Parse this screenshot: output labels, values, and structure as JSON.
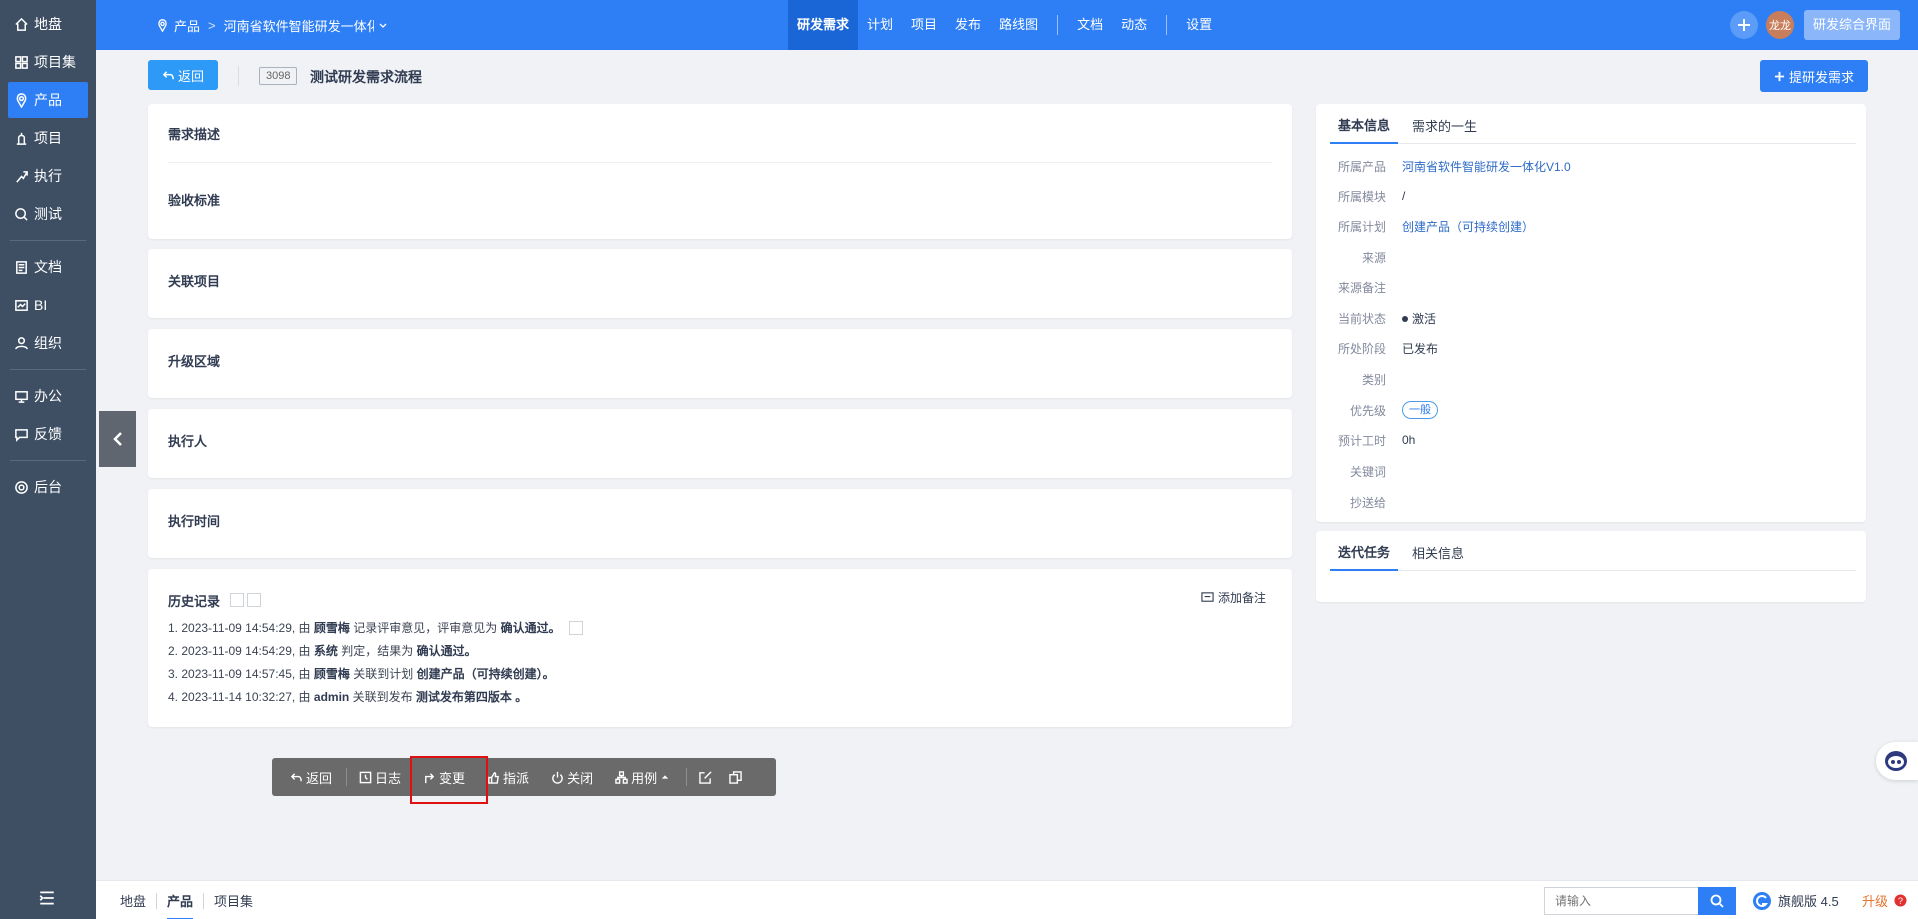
{
  "sidebar": {
    "items": [
      {
        "label": "地盘",
        "icon": "home-icon"
      },
      {
        "label": "项目集",
        "icon": "program-icon"
      },
      {
        "label": "产品",
        "icon": "product-icon"
      },
      {
        "label": "项目",
        "icon": "project-icon"
      },
      {
        "label": "执行",
        "icon": "execution-icon"
      },
      {
        "label": "测试",
        "icon": "test-icon"
      },
      {
        "label": "文档",
        "icon": "doc-icon"
      },
      {
        "label": "BI",
        "icon": "bi-icon"
      },
      {
        "label": "组织",
        "icon": "org-icon"
      },
      {
        "label": "办公",
        "icon": "office-icon"
      },
      {
        "label": "反馈",
        "icon": "feedback-icon"
      },
      {
        "label": "后台",
        "icon": "admin-icon"
      }
    ],
    "active": "产品"
  },
  "topbar": {
    "crumb_product": "产品",
    "crumb_current": "河南省软件智能研发一体化",
    "nav": [
      "研发需求",
      "计划",
      "项目",
      "发布",
      "路线图",
      "文档",
      "动态",
      "设置"
    ],
    "active_nav": "研发需求",
    "avatar_text": "龙龙",
    "switch_label": "研发综合界面"
  },
  "header": {
    "back_label": "返回",
    "story_id": "3098",
    "story_title": "测试研发需求流程",
    "create_label": "提研发需求"
  },
  "sections": {
    "desc": "需求描述",
    "verify": "验收标准",
    "linked_project": "关联项目",
    "upgrade_area": "升级区域",
    "executor": "执行人",
    "exec_time": "执行时间"
  },
  "history": {
    "title": "历史记录",
    "add_note": "添加备注",
    "entries": [
      {
        "prefix": "1. 2023-11-09 14:54:29, 由 ",
        "actor": "顾雪梅",
        "action": " 记录评审意见，评审意见为 ",
        "object": "确认通过。"
      },
      {
        "prefix": "2. 2023-11-09 14:54:29, 由 ",
        "actor": "系统",
        "action": " 判定，结果为 ",
        "object": "确认通过。"
      },
      {
        "prefix": "3. 2023-11-09 14:57:45, 由 ",
        "actor": "顾雪梅",
        "action": " 关联到计划 ",
        "object": "创建产品（可持续创建）。"
      },
      {
        "prefix": "4. 2023-11-14 10:32:27, 由 ",
        "actor": "admin",
        "action": " 关联到发布 ",
        "object": "测试发布第四版本 。"
      }
    ]
  },
  "toolbar": {
    "back": "返回",
    "log": "日志",
    "change": "变更",
    "assign": "指派",
    "close": "关闭",
    "case": "用例"
  },
  "info_panel": {
    "tabs": [
      "基本信息",
      "需求的一生"
    ],
    "rows": [
      {
        "label": "所属产品",
        "value": "河南省软件智能研发一体化V1.0"
      },
      {
        "label": "所属模块",
        "value": "/"
      },
      {
        "label": "所属计划",
        "value": "创建产品（可持续创建）"
      },
      {
        "label": "来源",
        "value": ""
      },
      {
        "label": "来源备注",
        "value": ""
      },
      {
        "label": "当前状态",
        "value": "激活"
      },
      {
        "label": "所处阶段",
        "value": "已发布"
      },
      {
        "label": "类别",
        "value": ""
      },
      {
        "label": "优先级",
        "value": "一般"
      },
      {
        "label": "预计工时",
        "value": "0h"
      },
      {
        "label": "关键词",
        "value": ""
      },
      {
        "label": "抄送给",
        "value": ""
      }
    ]
  },
  "task_panel": {
    "tabs": [
      "迭代任务",
      "相关信息"
    ]
  },
  "bottombar": {
    "nav": [
      "地盘",
      "产品",
      "项目集"
    ],
    "active": "产品",
    "search_placeholder": "请输入",
    "edition": "旗舰版 4.5",
    "upgrade": "升级"
  },
  "colors": {
    "primary": "#2e7ff6",
    "sidebar": "#3e4f64",
    "highlight": "#e01010"
  }
}
